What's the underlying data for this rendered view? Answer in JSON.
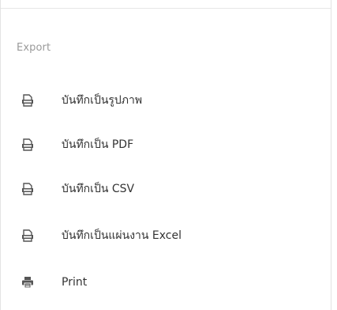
{
  "export_menu": {
    "section_label": "Export",
    "items": [
      {
        "label": "บันทึกเป็นรูปภาพ",
        "icon": "image-file-icon"
      },
      {
        "label": "บันทึกเป็น PDF",
        "icon": "pdf-file-icon"
      },
      {
        "label": "บันทึกเป็น CSV",
        "icon": "csv-file-icon"
      },
      {
        "label": "บันทึกเป็นแผ่นงาน Excel",
        "icon": "excel-file-icon"
      },
      {
        "label": "Print",
        "icon": "printer-icon"
      }
    ]
  },
  "colors": {
    "icon": "#555555",
    "text": "#333333",
    "section_label": "#9a9a9a"
  }
}
